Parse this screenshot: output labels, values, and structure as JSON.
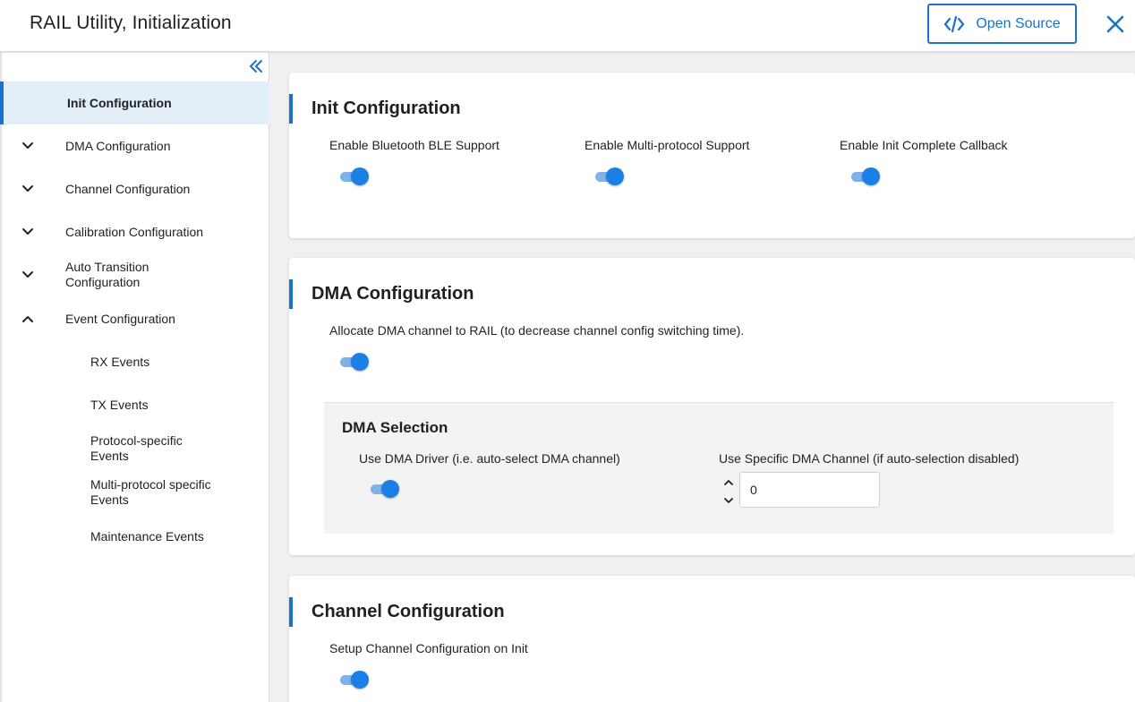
{
  "header": {
    "title": "RAIL Utility, Initialization",
    "open_source_label": "Open Source",
    "accent_color": "#1a73c8"
  },
  "sidebar": {
    "items": [
      {
        "label": "Init Configuration",
        "active": true
      },
      {
        "label": "DMA Configuration",
        "chevron": "chevron-down-icon"
      },
      {
        "label": "Channel Configuration",
        "chevron": "chevron-down-icon"
      },
      {
        "label": "Calibration Configuration",
        "chevron": "chevron-down-icon"
      },
      {
        "label": "Auto Transition Configuration",
        "chevron": "chevron-down-icon"
      },
      {
        "label": "Event Configuration",
        "chevron": "chevron-up-icon"
      },
      {
        "label": "RX Events"
      },
      {
        "label": "TX Events"
      },
      {
        "label": "Protocol-specific Events"
      },
      {
        "label": "Multi-protocol specific Events"
      },
      {
        "label": "Maintenance Events"
      }
    ]
  },
  "init_config": {
    "title": "Init Configuration",
    "fields": [
      {
        "label": "Enable Bluetooth BLE Support",
        "enabled": true
      },
      {
        "label": "Enable Multi-protocol Support",
        "enabled": true
      },
      {
        "label": "Enable Init Complete Callback",
        "enabled": true
      }
    ]
  },
  "dma_config": {
    "title": "DMA Configuration",
    "allocate_label": "Allocate DMA channel to RAIL (to decrease channel config switching time).",
    "allocate_enabled": true,
    "selection": {
      "title": "DMA Selection",
      "use_driver_label": "Use DMA Driver (i.e. auto-select DMA channel)",
      "use_driver_enabled": true,
      "specific_label": "Use Specific DMA Channel (if auto-selection disabled)",
      "specific_value": "0"
    }
  },
  "channel_config": {
    "title": "Channel Configuration",
    "setup_label": "Setup Channel Configuration on Init",
    "setup_enabled": true
  }
}
